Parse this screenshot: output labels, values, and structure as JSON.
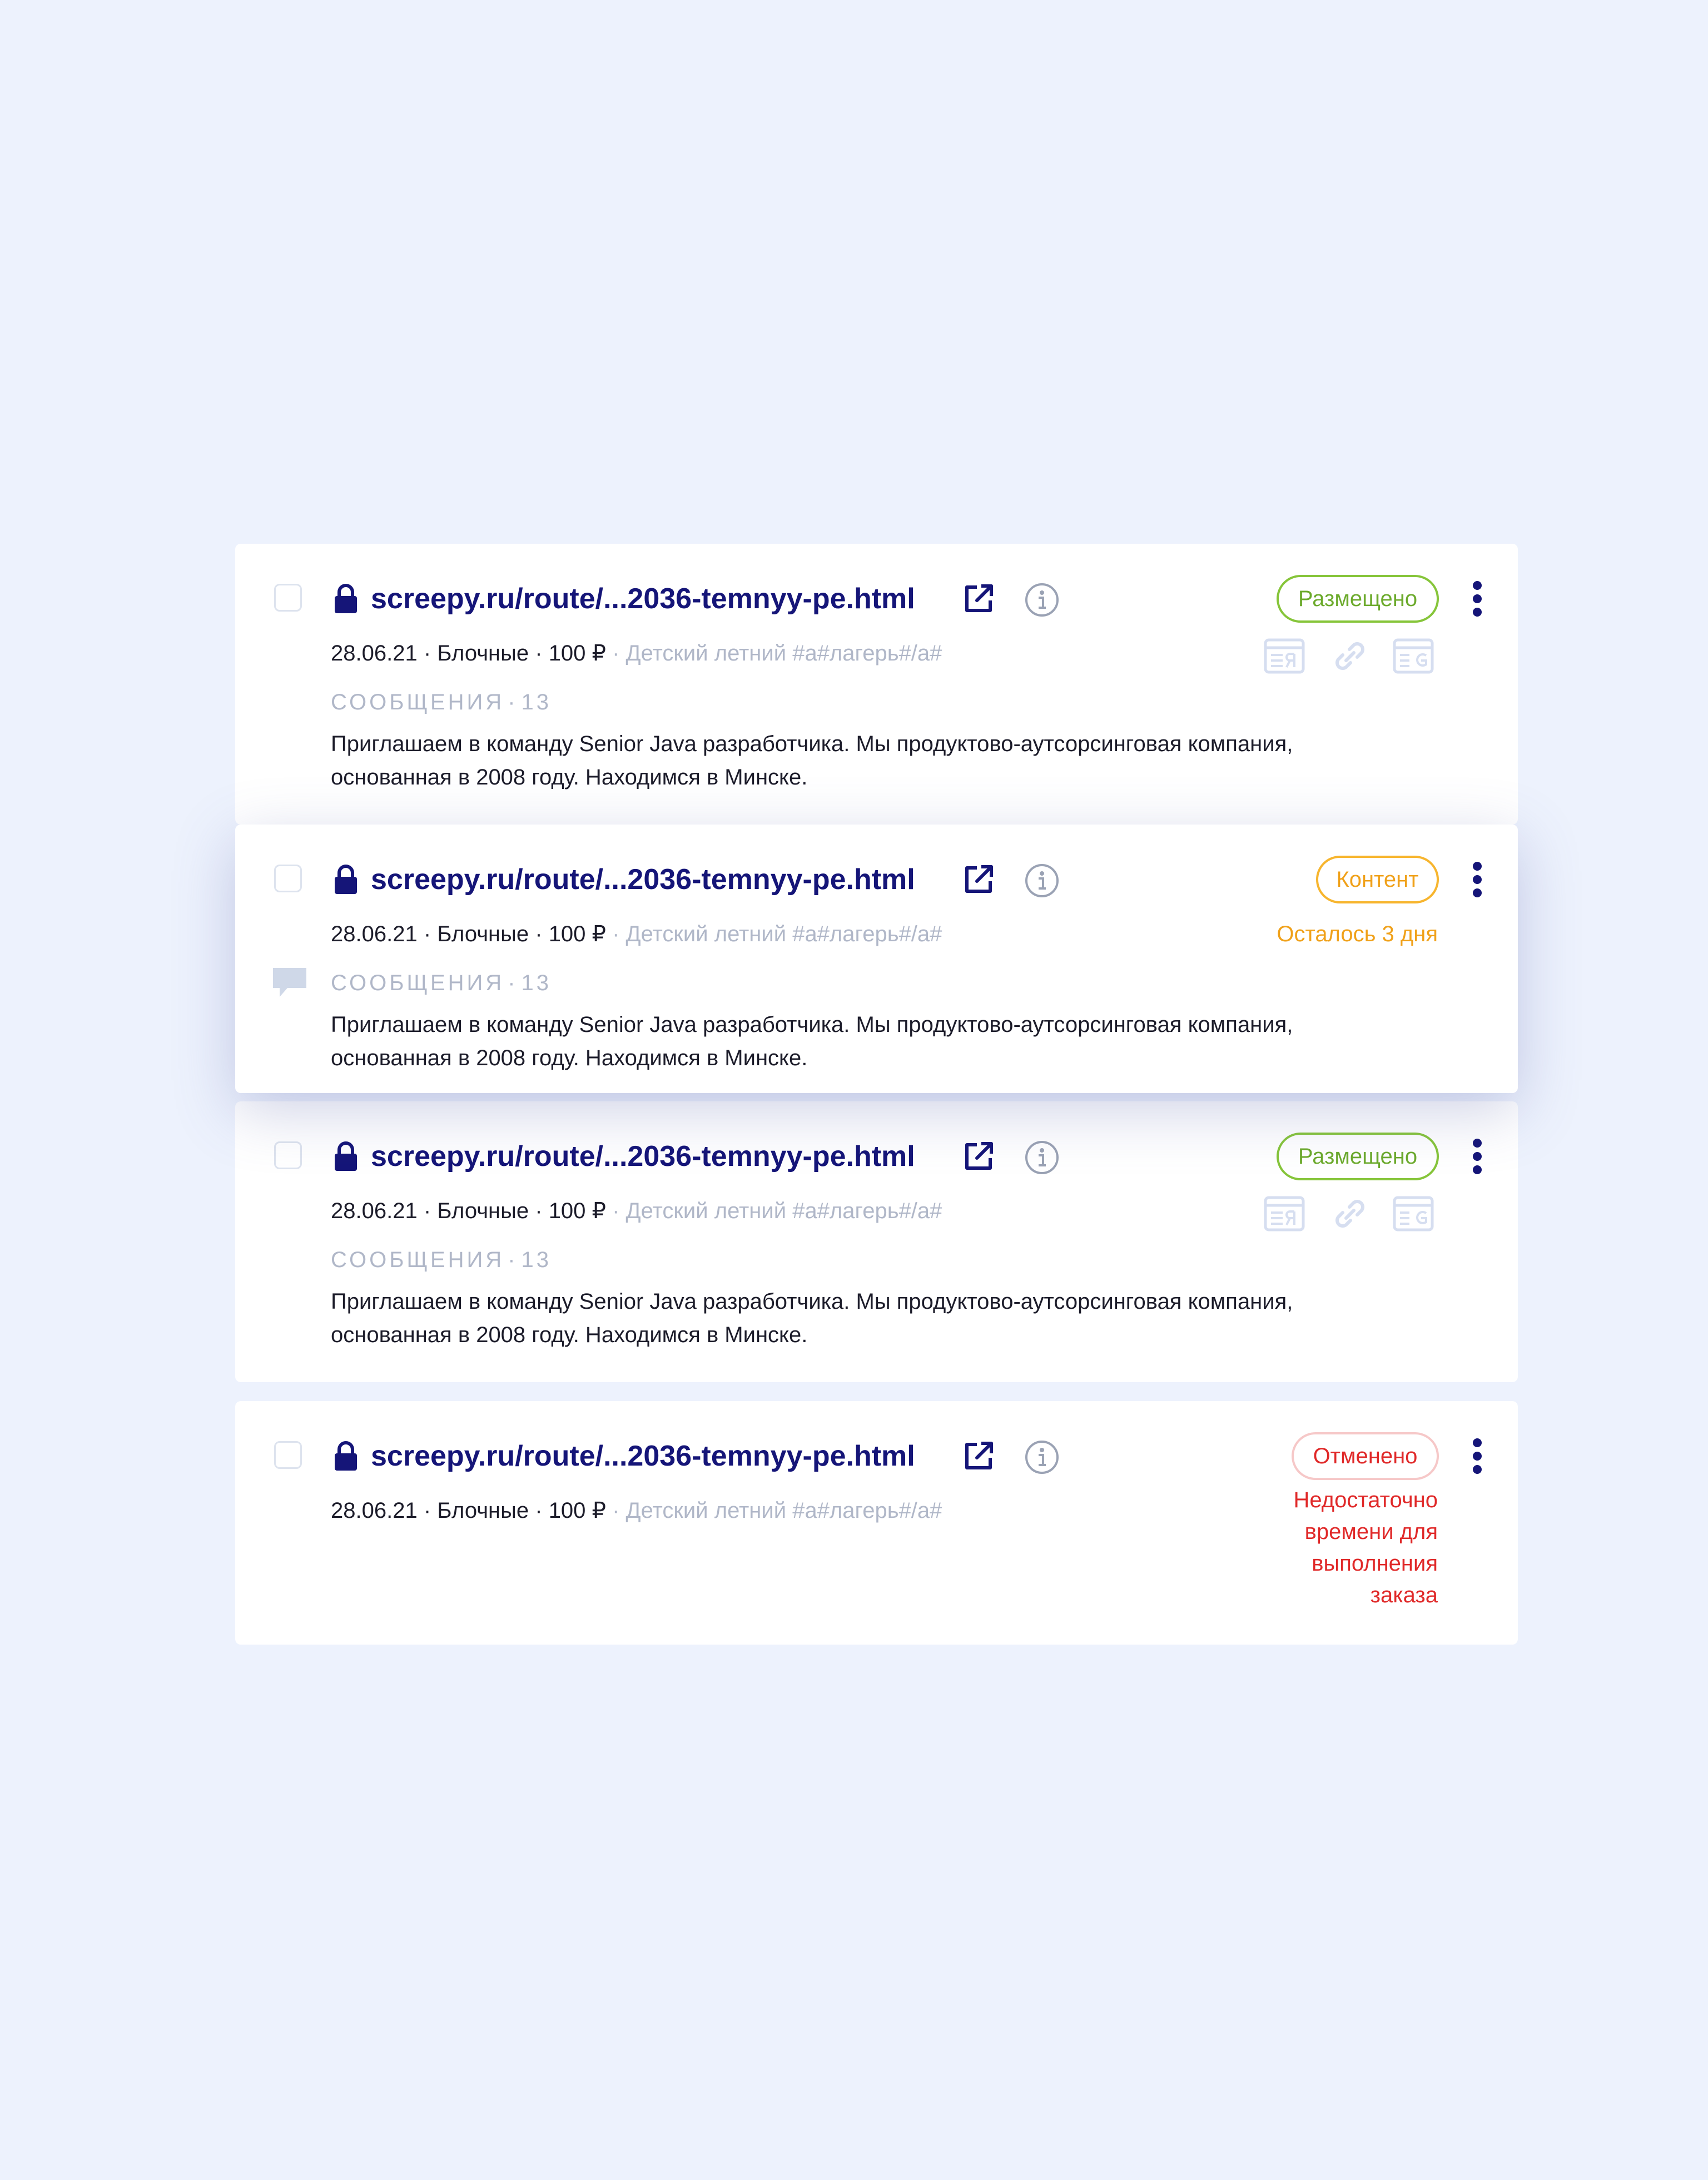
{
  "colors": {
    "background": "#edf2fd",
    "url": "#151578",
    "status_placed": "#86c53a",
    "status_content": "#f7b52e",
    "status_cancelled": "#e02929",
    "muted": "#b0b7c8"
  },
  "cards": [
    {
      "url": "screepy.ru/route/...2036-temnyy-pe.html",
      "date": "28.06.21",
      "type": "Блочные",
      "price": "100 ₽",
      "anchor": "Детский летний #а#лагерь#/а#",
      "status": "Размещено",
      "messages_label": "СООБЩЕНИЯ",
      "messages_count": "13",
      "message": "Приглашаем в команду Senior Java разработчика. Мы продуктово-аутсорсинговая компания, основанная в 2008 году. Находимся в Минске.",
      "tool_icons": [
        "yandex-index-icon",
        "link-icon",
        "google-index-icon"
      ]
    },
    {
      "url": "screepy.ru/route/...2036-temnyy-pe.html",
      "date": "28.06.21",
      "type": "Блочные",
      "price": "100 ₽",
      "anchor": "Детский летний #а#лагерь#/а#",
      "status": "Контент",
      "deadline": "Осталось 3 дня",
      "messages_label": "СООБЩЕНИЯ",
      "messages_count": "13",
      "message": "Приглашаем в команду Senior Java разработчика. Мы продуктово-аутсорсинговая компания, основанная в 2008 году. Находимся в Минске."
    },
    {
      "url": "screepy.ru/route/...2036-temnyy-pe.html",
      "date": "28.06.21",
      "type": "Блочные",
      "price": "100 ₽",
      "anchor": "Детский летний #а#лагерь#/а#",
      "status": "Размещено",
      "messages_label": "СООБЩЕНИЯ",
      "messages_count": "13",
      "message": "Приглашаем в команду Senior Java разработчика. Мы продуктово-аутсорсинговая компания, основанная в 2008 году. Находимся в Минске.",
      "tool_icons": [
        "yandex-index-icon",
        "link-icon",
        "google-index-icon"
      ]
    },
    {
      "url": "screepy.ru/route/...2036-temnyy-pe.html",
      "date": "28.06.21",
      "type": "Блочные",
      "price": "100 ₽",
      "anchor": "Детский летний #а#лагерь#/а#",
      "status": "Отменено",
      "cancel_reason": "Недостаточно времени для выполнения заказа"
    }
  ]
}
